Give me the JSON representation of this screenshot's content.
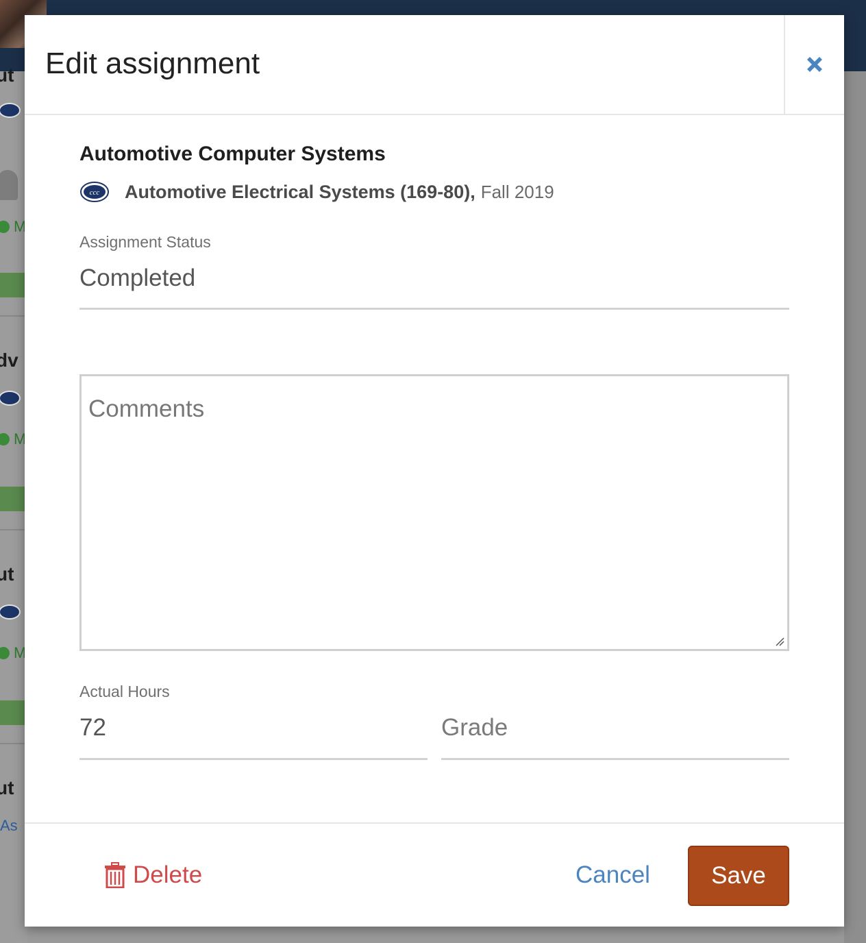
{
  "modal": {
    "title": "Edit assignment",
    "close_icon": "close-x-icon"
  },
  "assignment": {
    "title": "Automotive Computer Systems",
    "course_name": "Automotive Electrical Systems (169-80),",
    "term": "Fall 2019"
  },
  "fields": {
    "status_label": "Assignment Status",
    "status_value": "Completed",
    "comments_placeholder": "Comments",
    "hours_label": "Actual Hours",
    "hours_value": "72",
    "grade_placeholder": "Grade"
  },
  "footer": {
    "delete_label": "Delete",
    "cancel_label": "Cancel",
    "save_label": "Save"
  },
  "background": {
    "fragments": [
      "ut",
      "dv",
      "ut",
      "ut"
    ],
    "check_labels": [
      "M",
      "M",
      "M"
    ],
    "link_text": "As"
  },
  "colors": {
    "topbar": "#1b2f48",
    "close_icon": "#4a85c2",
    "delete": "#cf4a4a",
    "cancel": "#4a85c2",
    "save_bg": "#ad4a1c"
  }
}
